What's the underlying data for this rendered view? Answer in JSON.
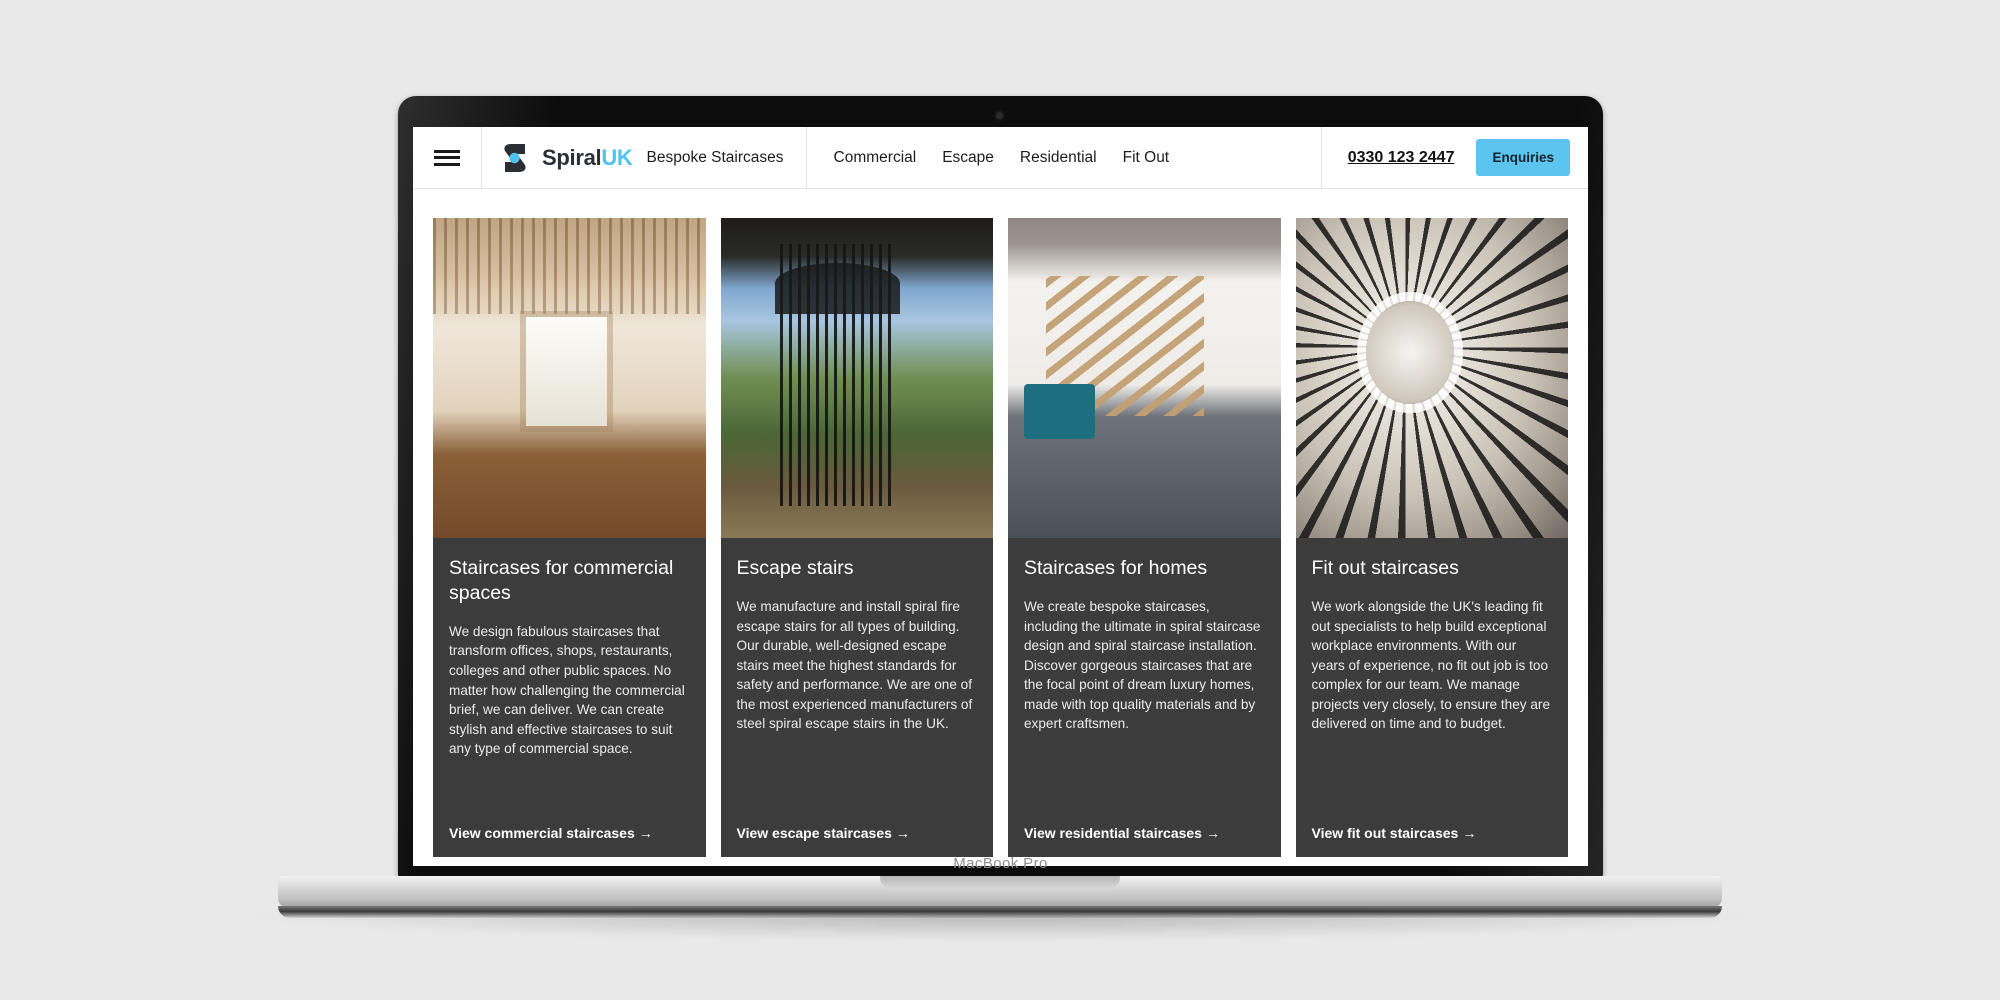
{
  "device": {
    "model_label": "MacBook Pro",
    "webcam_icon": "camera-dot-icon"
  },
  "header": {
    "menu_icon": "hamburger-menu-icon",
    "logo": {
      "mark_icon": "spiral-s-logo-icon",
      "word_dark": "Spiral",
      "word_accent": "UK",
      "accent_color": "#4ec3f0"
    },
    "tagline": "Bespoke Staircases",
    "nav_items": [
      {
        "label": "Commercial"
      },
      {
        "label": "Escape"
      },
      {
        "label": "Residential"
      },
      {
        "label": "Fit Out"
      }
    ],
    "phone": "0330 123 2447",
    "cta_label": "Enquiries",
    "cta_color": "#5bc5ef"
  },
  "cards": [
    {
      "image_name": "commercial-staircase-photo",
      "title": "Staircases for commercial spaces",
      "body": "We design fabulous staircases that transform offices, shops, restaurants, colleges and other public spaces. No matter how challenging the commercial brief, we can deliver. We can create stylish and effective staircases to suit any type of commercial space.",
      "link_label": "View commercial staircases",
      "link_arrow": "→"
    },
    {
      "image_name": "escape-staircase-photo",
      "title": "Escape stairs",
      "body": "We manufacture and install spiral fire escape stairs for all types of building. Our durable, well-designed escape stairs meet the highest standards for safety and performance. We are one of the most experienced manufacturers of steel spiral escape stairs in the UK.",
      "link_label": "View escape staircases",
      "link_arrow": "→"
    },
    {
      "image_name": "residential-staircase-photo",
      "title": "Staircases for homes",
      "body": "We create bespoke staircases, including the ultimate in spiral staircase design and spiral staircase installation. Discover gorgeous staircases that are the focal point of dream luxury homes, made with top quality materials and by expert craftsmen.",
      "link_label": "View residential staircases",
      "link_arrow": "→"
    },
    {
      "image_name": "fit-out-staircase-photo",
      "title": "Fit out staircases",
      "body": "We work alongside the UK's leading fit out specialists to help build exceptional workplace environments. With our years of experience, no fit out job is too complex for our team. We manage projects very closely, to ensure they are delivered on time and to budget.",
      "link_label": "View fit out staircases",
      "link_arrow": "→"
    }
  ],
  "theme": {
    "card_background": "#3c3c3c",
    "page_background": "#e9e9e9"
  }
}
